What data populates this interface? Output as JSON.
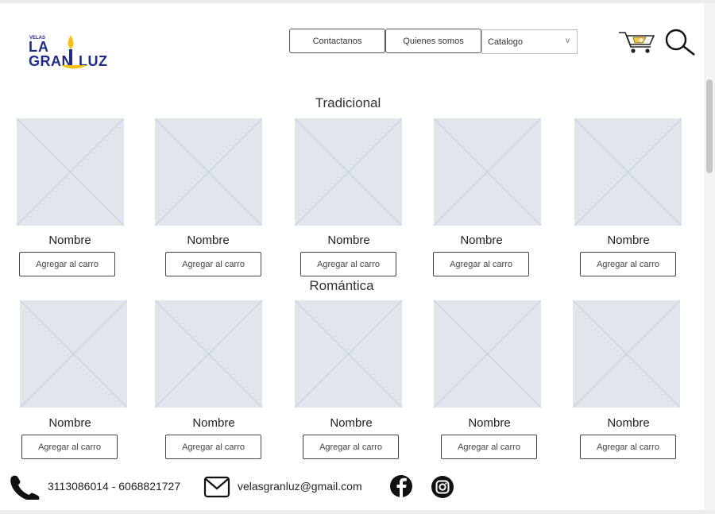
{
  "logo": {
    "small_text": "VELAS",
    "line1": "LA",
    "line2": "GRAN",
    "line3": "LUZ",
    "brand_color": "#1d2b8c",
    "flame_color": "#f3c215"
  },
  "nav": {
    "contact_label": "Contactanos",
    "about_label": "Quienes somos",
    "catalog_select": {
      "selected": "Catalogo"
    }
  },
  "icons": {
    "cart": "shopping-cart-icon",
    "search": "search-icon"
  },
  "sections": [
    {
      "title": "Tradicional",
      "products": [
        {
          "name": "Nombre",
          "button": "Agregar al carro"
        },
        {
          "name": "Nombre",
          "button": "Agregar al carro"
        },
        {
          "name": "Nombre",
          "button": "Agregar al carro"
        },
        {
          "name": "Nombre",
          "button": "Agregar al carro"
        },
        {
          "name": "Nombre",
          "button": "Agregar al carro"
        }
      ]
    },
    {
      "title": "Romántica",
      "products": [
        {
          "name": "Nombre",
          "button": "Agregar al carro"
        },
        {
          "name": "Nombre",
          "button": "Agregar al carro"
        },
        {
          "name": "Nombre",
          "button": "Agregar al carro"
        },
        {
          "name": "Nombre",
          "button": "Agregar al carro"
        },
        {
          "name": "Nombre",
          "button": "Agregar al carro"
        }
      ]
    }
  ],
  "footer": {
    "phone": "3113086014 - 6068821727",
    "email": "velasgranluz@gmail.com"
  },
  "colors": {
    "placeholder_fill": "#e1e5ec",
    "placeholder_line": "#c5ccd6"
  }
}
